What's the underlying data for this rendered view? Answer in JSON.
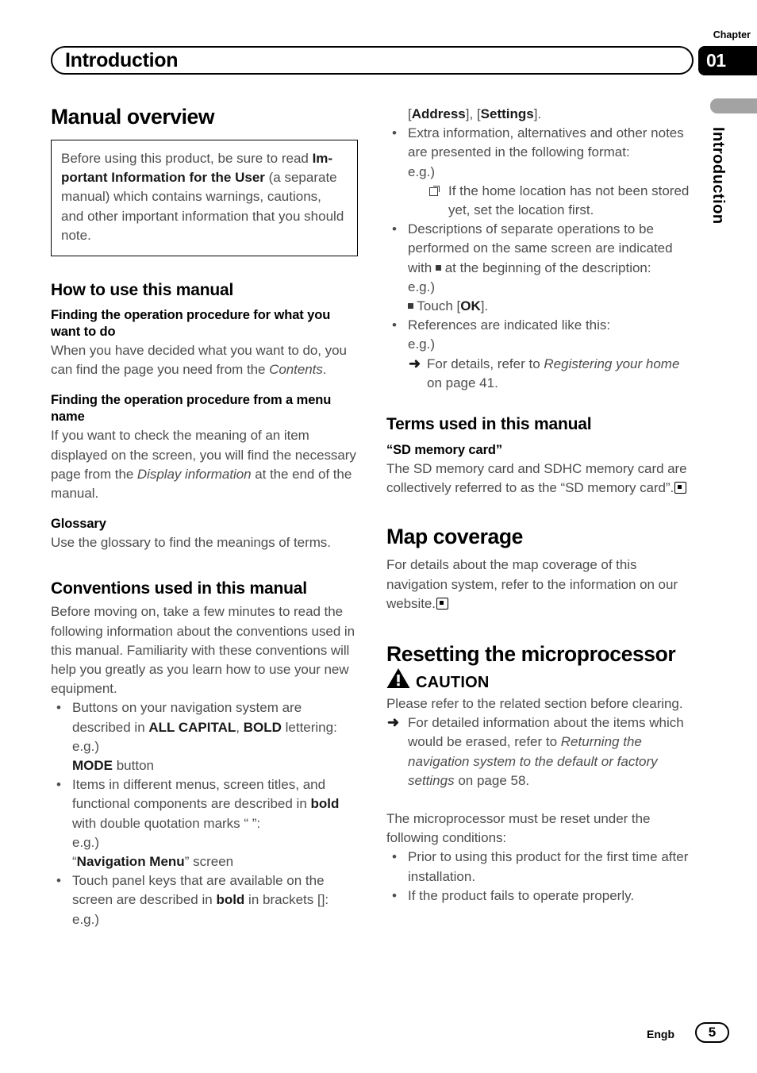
{
  "header": {
    "chapter_label": "Chapter",
    "title": "Introduction",
    "chapter_number": "01"
  },
  "side_tab": {
    "label": "Introduction"
  },
  "left_column": {
    "section_title": "Manual overview",
    "note_box": {
      "part1": "Before using this product, be sure to read ",
      "bold1": "Im-",
      "bold2": "portant Information for the User",
      "part2": " (a separate manual) which contains warnings, cautions, and other important information that you should note."
    },
    "how_to_heading": "How to use this manual",
    "finding_procedure_heading": "Finding the operation procedure for what you want to do",
    "finding_procedure_body_1": "When you have decided what you want to do, you can find the page you need from the ",
    "finding_procedure_italic": "Contents",
    "finding_procedure_body_2": ".",
    "menu_name_heading": "Finding the operation procedure from a menu name",
    "menu_name_body_1": "If you want to check the meaning of an item displayed on the screen, you will find the necessary page from the ",
    "menu_name_italic": "Display information",
    "menu_name_body_2": " at the end of the manual.",
    "glossary_heading": "Glossary",
    "glossary_body": "Use the glossary to find the meanings of terms.",
    "conventions_heading": "Conventions used in this manual",
    "conventions_body": "Before moving on, take a few minutes to read the following information about the conventions used in this manual. Familiarity with these conventions will help you greatly as you learn how to use your new equipment.",
    "bullet1_a": "Buttons on your navigation system are described in ",
    "bullet1_bold1": "ALL CAPITAL",
    "bullet1_b": ", ",
    "bullet1_bold2": "BOLD",
    "bullet1_c": " lettering:",
    "bullet1_eg": "e.g.)",
    "bullet1_ex_bold": "MODE",
    "bullet1_ex_rest": " button",
    "bullet2_a": "Items in different menus, screen titles, and functional components are described in ",
    "bullet2_bold": "bold",
    "bullet2_b": " with double quotation marks “ ”:",
    "bullet2_eg": "e.g.)",
    "bullet2_ex_pre": "“",
    "bullet2_ex_bold": "Navigation Menu",
    "bullet2_ex_post": "” screen",
    "bullet3_a": "Touch panel keys that are available on the screen are described in ",
    "bullet3_bold": "bold",
    "bullet3_b": " in brackets []:",
    "bullet3_eg": "e.g.)"
  },
  "right_column": {
    "cont_pre": "[",
    "cont_bold1": "Address",
    "cont_mid": "], [",
    "cont_bold2": "Settings",
    "cont_post": "].",
    "bullet1": "Extra information, alternatives and other notes are presented in the following format:",
    "bullet1_eg": "e.g.)",
    "bullet1_note": "If the home location has not been stored yet, set the location first.",
    "bullet2_a": "Descriptions of separate operations to be performed on the same screen are indicated with ",
    "bullet2_b": " at the beginning of the description:",
    "bullet2_eg": "e.g.)",
    "bullet2_ex_a": "Touch [",
    "bullet2_ex_bold": "OK",
    "bullet2_ex_b": "].",
    "bullet3": "References are indicated like this:",
    "bullet3_eg": "e.g.)",
    "bullet3_ref_a": "For details, refer to ",
    "bullet3_ref_italic": "Registering your home",
    "bullet3_ref_b": " on page 41.",
    "terms_heading": "Terms used in this manual",
    "sd_heading": "“SD memory card”",
    "sd_body": "The SD memory card and SDHC memory card are collectively referred to as the “SD memory card”.",
    "map_heading": "Map coverage",
    "map_body": "For details about the map coverage of this navigation system, refer to the information on our website.",
    "reset_heading": "Resetting the microprocessor",
    "caution_word": "CAUTION",
    "caution_body": "Please refer to the related section before clearing.",
    "caution_ref_a": "For detailed information about the items which would be erased, refer to ",
    "caution_ref_italic": "Returning the navigation system to the default or factory settings",
    "caution_ref_b": " on page 58.",
    "reset_intro": "The microprocessor must be reset under the following conditions:",
    "reset_bullet1": "Prior to using this product for the first time after installation.",
    "reset_bullet2": "If the product fails to operate properly."
  },
  "footer": {
    "language": "Engb",
    "page_number": "5"
  },
  "icons": {
    "note_flag": "note-flag-icon",
    "square_bullet": "square-bullet-icon",
    "end_mark": "end-of-section-icon",
    "reference_arrow": "reference-arrow-icon",
    "caution_triangle": "caution-triangle-icon"
  },
  "colors": {
    "body_text": "#4d4d4d",
    "heading_text": "#000000",
    "side_tab_gray": "#a3a3a3",
    "chapter_box": "#000000"
  }
}
